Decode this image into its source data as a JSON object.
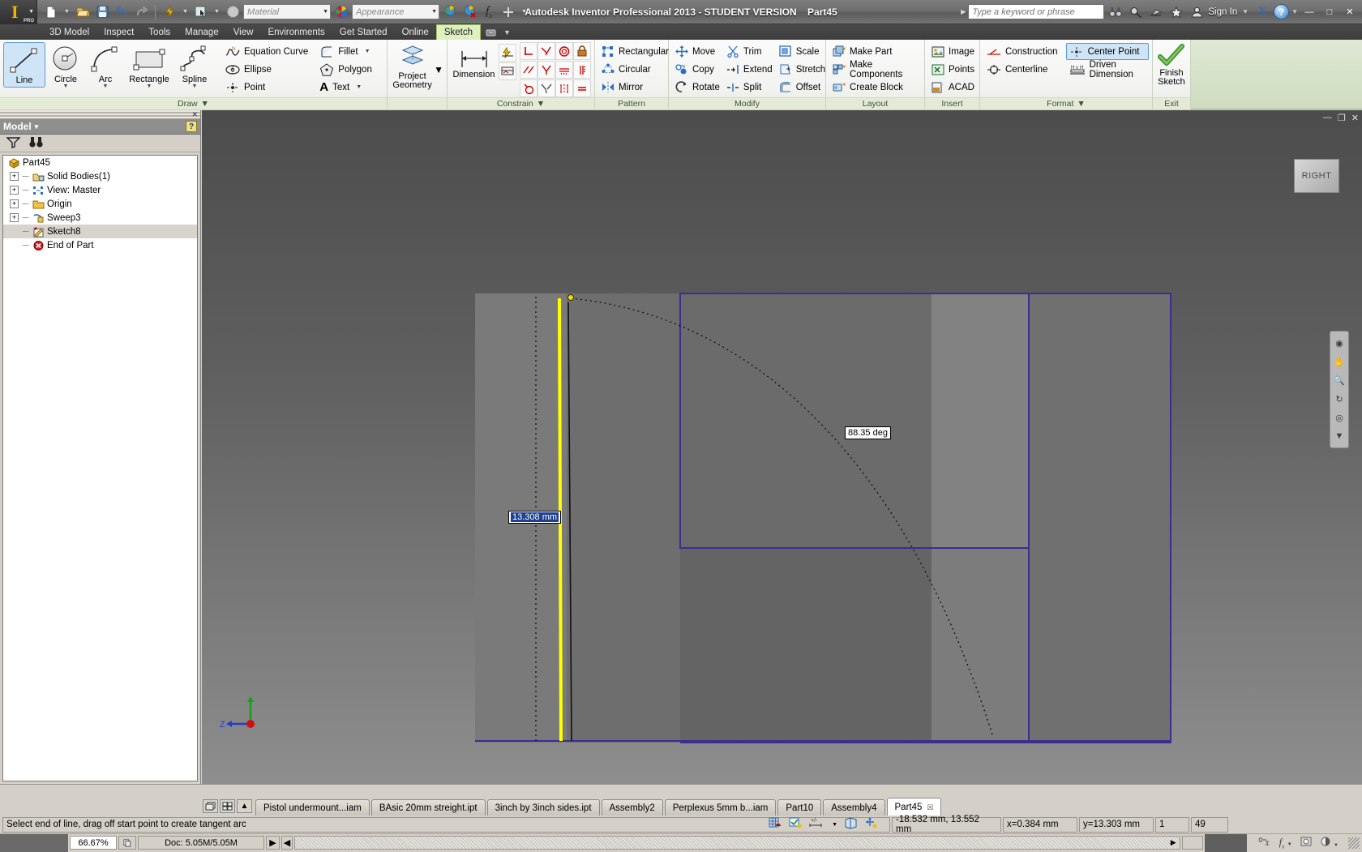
{
  "titlebar": {
    "app_title": "Autodesk Inventor Professional 2013 - STUDENT VERSION",
    "document_name": "Part45",
    "material_placeholder": "Material",
    "appearance_placeholder": "Appearance",
    "search_placeholder": "Type a keyword or phrase",
    "signin_label": "Sign In",
    "logo_letter": "I",
    "logo_pro": "PRO",
    "minimize": "—",
    "maximize": "□",
    "close": "✕",
    "help_glyph": "?",
    "exchange_glyph": "X"
  },
  "menu_tabs": [
    {
      "label": "3D Model",
      "active": false
    },
    {
      "label": "Inspect",
      "active": false
    },
    {
      "label": "Tools",
      "active": false
    },
    {
      "label": "Manage",
      "active": false
    },
    {
      "label": "View",
      "active": false
    },
    {
      "label": "Environments",
      "active": false
    },
    {
      "label": "Get Started",
      "active": false
    },
    {
      "label": "Online",
      "active": false
    },
    {
      "label": "Sketch",
      "active": true
    }
  ],
  "ribbon": {
    "panels": [
      {
        "title": "Draw",
        "has_dropdown": true
      },
      {
        "title": "",
        "has_dropdown": false
      },
      {
        "title": "Constrain",
        "has_dropdown": true
      },
      {
        "title": "Pattern",
        "has_dropdown": false
      },
      {
        "title": "Modify",
        "has_dropdown": false
      },
      {
        "title": "Layout",
        "has_dropdown": false
      },
      {
        "title": "Insert",
        "has_dropdown": false
      },
      {
        "title": "Format",
        "has_dropdown": true
      },
      {
        "title": "Exit",
        "has_dropdown": false
      }
    ],
    "draw": {
      "big_buttons": [
        {
          "label": "Line",
          "selected": true,
          "dropdown": true
        },
        {
          "label": "Circle",
          "selected": false,
          "dropdown": true
        },
        {
          "label": "Arc",
          "selected": false,
          "dropdown": true
        },
        {
          "label": "Rectangle",
          "selected": false,
          "dropdown": true
        },
        {
          "label": "Spline",
          "selected": false,
          "dropdown": true
        }
      ],
      "col1": [
        {
          "label": "Equation Curve",
          "dropdown": false
        },
        {
          "label": "Ellipse",
          "dropdown": false
        },
        {
          "label": "Point",
          "dropdown": false
        }
      ],
      "col2": [
        {
          "label": "Fillet",
          "dropdown": true
        },
        {
          "label": "Polygon",
          "dropdown": false
        },
        {
          "label": "Text",
          "dropdown": true
        }
      ]
    },
    "project_geometry": {
      "label_line1": "Project",
      "label_line2": "Geometry",
      "dropdown": true
    },
    "constrain": {
      "dimension_label": "Dimension"
    },
    "pattern": [
      {
        "label": "Rectangular"
      },
      {
        "label": "Circular"
      },
      {
        "label": "Mirror"
      }
    ],
    "modify": {
      "col1": [
        {
          "label": "Move"
        },
        {
          "label": "Copy"
        },
        {
          "label": "Rotate"
        }
      ],
      "col2": [
        {
          "label": "Trim"
        },
        {
          "label": "Extend"
        },
        {
          "label": "Split"
        }
      ],
      "col3": [
        {
          "label": "Scale"
        },
        {
          "label": "Stretch"
        },
        {
          "label": "Offset"
        }
      ]
    },
    "layout": [
      {
        "label": "Make Part"
      },
      {
        "label": "Make Components"
      },
      {
        "label": "Create Block"
      }
    ],
    "insert": [
      {
        "label": "Image"
      },
      {
        "label": "Points"
      },
      {
        "label": "ACAD"
      }
    ],
    "format": {
      "col1": [
        {
          "label": "Construction",
          "selected": false
        },
        {
          "label": "Centerline",
          "selected": false
        }
      ],
      "col2": [
        {
          "label": "Center Point",
          "selected": true
        },
        {
          "label": "Driven Dimension",
          "selected": false
        }
      ]
    },
    "exit": {
      "label_line1": "Finish",
      "label_line2": "Sketch"
    }
  },
  "browser": {
    "panel_title": "Model",
    "dropdown_glyph": "▾",
    "help_glyph": "?",
    "close_glyph": "✕",
    "filter_icon": "filter-icon",
    "find_icon": "binoculars-icon",
    "tree": [
      {
        "label": "Part45",
        "indent": 0,
        "expander": "none",
        "icon": "part-icon",
        "selected": false
      },
      {
        "label": "Solid Bodies(1)",
        "indent": 1,
        "expander": "plus",
        "icon": "solid-bodies-icon",
        "selected": false
      },
      {
        "label": "View: Master",
        "indent": 1,
        "expander": "plus",
        "icon": "view-master-icon",
        "selected": false
      },
      {
        "label": "Origin",
        "indent": 1,
        "expander": "plus",
        "icon": "folder-icon",
        "selected": false
      },
      {
        "label": "Sweep3",
        "indent": 1,
        "expander": "plus",
        "icon": "sweep-icon",
        "selected": false
      },
      {
        "label": "Sketch8",
        "indent": 1,
        "expander": "none",
        "icon": "sketch-icon",
        "selected": true
      },
      {
        "label": "End of Part",
        "indent": 1,
        "expander": "none",
        "icon": "end-of-part-icon",
        "selected": false
      }
    ]
  },
  "viewport": {
    "viewcube_label": "RIGHT",
    "dimension_label": "13.308 mm",
    "angle_label": "88.35 deg",
    "axis_z_label": "Z",
    "minimize_glyph": "—",
    "restore_glyph": "❐",
    "close_glyph": "✕"
  },
  "document_tabs": [
    {
      "label": "Pistol undermount...iam",
      "active": false,
      "closable": false
    },
    {
      "label": "BAsic 20mm streight.ipt",
      "active": false,
      "closable": false
    },
    {
      "label": "3inch by 3inch sides.ipt",
      "active": false,
      "closable": false
    },
    {
      "label": "Assembly2",
      "active": false,
      "closable": false
    },
    {
      "label": "Perplexus 5mm b...iam",
      "active": false,
      "closable": false
    },
    {
      "label": "Part10",
      "active": false,
      "closable": false
    },
    {
      "label": "Assembly4",
      "active": false,
      "closable": false
    },
    {
      "label": "Part45",
      "active": true,
      "closable": true
    }
  ],
  "statusbar": {
    "prompt": "Select end of line, drag off start point to create tangent arc",
    "coordinate_readout": "-18.532 mm, 13.552 mm",
    "x_value": "x=0.384 mm",
    "y_value": "y=13.303 mm",
    "field_1": "1",
    "field_2": "49"
  },
  "bottombar": {
    "zoom_level": "66.67%",
    "doc_memory": "Doc: 5.05M/5.05M"
  },
  "colors": {
    "accent_green": "#7fb23f",
    "selection_blue": "#5b9bd5",
    "sketch_yellow": "#ffff00",
    "sketch_purple": "#3a2f8f",
    "title_bar": "#6e6e6e"
  }
}
